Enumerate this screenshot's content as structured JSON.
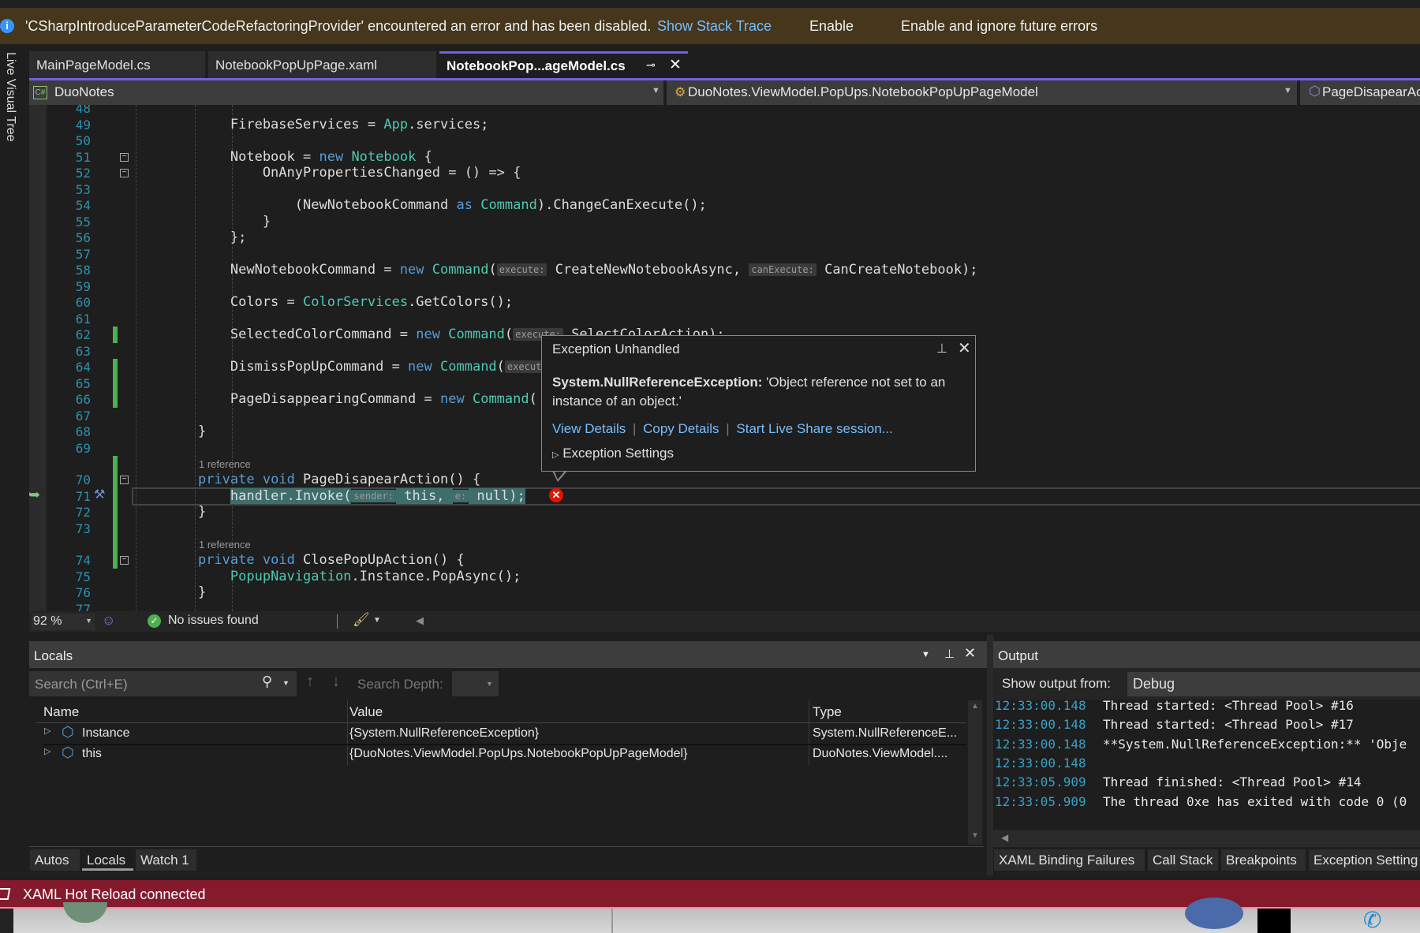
{
  "infobar": {
    "icon": "info-icon",
    "message": "'CSharpIntroduceParameterCodeRefactoringProvider' encountered an error and has been disabled.",
    "show_stack_trace": "Show Stack Trace",
    "enable": "Enable",
    "enable_ignore": "Enable and ignore future errors"
  },
  "side_panel": {
    "label": "Live Visual Tree"
  },
  "tabs": [
    {
      "label": "MainPageModel.cs",
      "active": false
    },
    {
      "label": "NotebookPopUpPage.xaml",
      "active": false
    },
    {
      "label": "NotebookPop...ageModel.cs",
      "active": true
    }
  ],
  "navbar": {
    "project": "DuoNotes",
    "class": "DuoNotes.ViewModel.PopUps.NotebookPopUpPageModel",
    "member": "PageDisapearAc"
  },
  "editor": {
    "reference_label": "1 reference",
    "current_line": 71,
    "changed_lines": [
      62,
      64,
      65,
      66,
      70,
      71,
      72,
      73,
      74
    ],
    "lines": [
      {
        "n": 48,
        "tokens": []
      },
      {
        "n": 49,
        "tokens": [
          {
            "t": "        FirebaseServices = "
          },
          {
            "t": "App",
            "c": "ty"
          },
          {
            "t": ".services;"
          }
        ]
      },
      {
        "n": 50,
        "tokens": []
      },
      {
        "n": 51,
        "fold": true,
        "tokens": [
          {
            "t": "        Notebook = "
          },
          {
            "t": "new",
            "c": "kw"
          },
          {
            "t": " "
          },
          {
            "t": "Notebook",
            "c": "ty"
          },
          {
            "t": " {"
          }
        ]
      },
      {
        "n": 52,
        "fold": true,
        "tokens": [
          {
            "t": "            OnAnyPropertiesChanged = () => {"
          }
        ]
      },
      {
        "n": 53,
        "tokens": []
      },
      {
        "n": 54,
        "tokens": [
          {
            "t": "                (NewNotebookCommand "
          },
          {
            "t": "as",
            "c": "kw"
          },
          {
            "t": " "
          },
          {
            "t": "Command",
            "c": "ty"
          },
          {
            "t": ").ChangeCanExecute();"
          }
        ]
      },
      {
        "n": 55,
        "tokens": [
          {
            "t": "            }"
          }
        ]
      },
      {
        "n": 56,
        "tokens": [
          {
            "t": "        };"
          }
        ]
      },
      {
        "n": 57,
        "tokens": []
      },
      {
        "n": 58,
        "tokens": [
          {
            "t": "        NewNotebookCommand = "
          },
          {
            "t": "new",
            "c": "kw"
          },
          {
            "t": " "
          },
          {
            "t": "Command",
            "c": "ty"
          },
          {
            "t": "("
          },
          {
            "t": "execute:",
            "c": "hint"
          },
          {
            "t": " CreateNewNotebookAsync, "
          },
          {
            "t": "canExecute:",
            "c": "hint"
          },
          {
            "t": " CanCreateNotebook);"
          }
        ]
      },
      {
        "n": 59,
        "tokens": []
      },
      {
        "n": 60,
        "tokens": [
          {
            "t": "        Colors = "
          },
          {
            "t": "ColorServices",
            "c": "ty"
          },
          {
            "t": ".GetColors();"
          }
        ]
      },
      {
        "n": 61,
        "tokens": []
      },
      {
        "n": 62,
        "tokens": [
          {
            "t": "        SelectedColorCommand = "
          },
          {
            "t": "new",
            "c": "kw"
          },
          {
            "t": " "
          },
          {
            "t": "Command",
            "c": "ty"
          },
          {
            "t": "("
          },
          {
            "t": "execute:",
            "c": "hint"
          },
          {
            "t": " SelectColorAction);"
          }
        ]
      },
      {
        "n": 63,
        "tokens": []
      },
      {
        "n": 64,
        "tokens": [
          {
            "t": "        DismissPopUpCommand = "
          },
          {
            "t": "new",
            "c": "kw"
          },
          {
            "t": " "
          },
          {
            "t": "Command",
            "c": "ty"
          },
          {
            "t": "("
          },
          {
            "t": "execute:",
            "c": "hint"
          }
        ]
      },
      {
        "n": 65,
        "tokens": []
      },
      {
        "n": 66,
        "tokens": [
          {
            "t": "        PageDisappearingCommand = "
          },
          {
            "t": "new",
            "c": "kw"
          },
          {
            "t": " "
          },
          {
            "t": "Command",
            "c": "ty"
          },
          {
            "t": "("
          }
        ]
      },
      {
        "n": 67,
        "tokens": []
      },
      {
        "n": 68,
        "tokens": [
          {
            "t": "    }"
          }
        ]
      },
      {
        "n": 69,
        "tokens": []
      },
      {
        "n": 70,
        "ref": true,
        "fold": true,
        "tokens": [
          {
            "t": "    "
          },
          {
            "t": "private",
            "c": "kw"
          },
          {
            "t": " "
          },
          {
            "t": "void",
            "c": "kw"
          },
          {
            "t": " PageDisapearAction() {"
          }
        ]
      },
      {
        "n": 71,
        "current": true,
        "tokens": [
          {
            "t": "        "
          },
          {
            "t": "handler.Invoke(",
            "c": "sel"
          },
          {
            "t": "sender:",
            "c": "hint sel"
          },
          {
            "t": " this, ",
            "c": "sel"
          },
          {
            "t": "e:",
            "c": "hint sel"
          },
          {
            "t": " null);",
            "c": "sel"
          }
        ]
      },
      {
        "n": 72,
        "tokens": [
          {
            "t": "    }"
          }
        ]
      },
      {
        "n": 73,
        "tokens": []
      },
      {
        "n": 74,
        "ref": true,
        "fold": true,
        "tokens": [
          {
            "t": "    "
          },
          {
            "t": "private",
            "c": "kw"
          },
          {
            "t": " "
          },
          {
            "t": "void",
            "c": "kw"
          },
          {
            "t": " ClosePopUpAction() {"
          }
        ]
      },
      {
        "n": 75,
        "tokens": [
          {
            "t": "        "
          },
          {
            "t": "PopupNavigation",
            "c": "ty"
          },
          {
            "t": ".Instance.PopAsync();"
          }
        ]
      },
      {
        "n": 76,
        "tokens": [
          {
            "t": "    }"
          }
        ]
      },
      {
        "n": 77,
        "tokens": []
      }
    ]
  },
  "exception_popup": {
    "title": "Exception Unhandled",
    "exception_type": "System.NullReferenceException:",
    "message_line1": " 'Object reference not set to an",
    "message_line2": "instance of an object.'",
    "links": [
      "View Details",
      "Copy Details",
      "Start Live Share session..."
    ],
    "settings": "Exception Settings"
  },
  "editor_status": {
    "zoom": "92 %",
    "issues": "No issues found"
  },
  "locals": {
    "title": "Locals",
    "search_placeholder": "Search (Ctrl+E)",
    "search_depth_label": "Search Depth:",
    "columns": [
      "Name",
      "Value",
      "Type"
    ],
    "rows": [
      {
        "name": "Instance",
        "value": "{System.NullReferenceException}",
        "type": "System.NullReferenceE..."
      },
      {
        "name": "this",
        "value": "{DuoNotes.ViewModel.PopUps.NotebookPopUpPageModel}",
        "type": "DuoNotes.ViewModel...."
      }
    ],
    "tabs": [
      {
        "label": "Autos",
        "active": false
      },
      {
        "label": "Locals",
        "active": true
      },
      {
        "label": "Watch 1",
        "active": false
      }
    ]
  },
  "output": {
    "title": "Output",
    "show_from_label": "Show output from:",
    "source": "Debug",
    "lines": [
      {
        "ts": "12:33:00.148",
        "msg": "Thread started: <Thread Pool> #16"
      },
      {
        "ts": "12:33:00.148",
        "msg": "Thread started: <Thread Pool> #17"
      },
      {
        "ts": "12:33:00.148",
        "msg": "**System.NullReferenceException:** 'Obje"
      },
      {
        "ts": "12:33:00.148",
        "msg": ""
      },
      {
        "ts": "12:33:05.909",
        "msg": "Thread finished: <Thread Pool> #14"
      },
      {
        "ts": "12:33:05.909",
        "msg": "The thread 0xe has exited with code 0 (0"
      }
    ],
    "tabs": [
      "XAML Binding Failures",
      "Call Stack",
      "Breakpoints",
      "Exception Setting"
    ]
  },
  "statusbar": {
    "text": "XAML Hot Reload connected",
    "color": "#861a2d"
  }
}
